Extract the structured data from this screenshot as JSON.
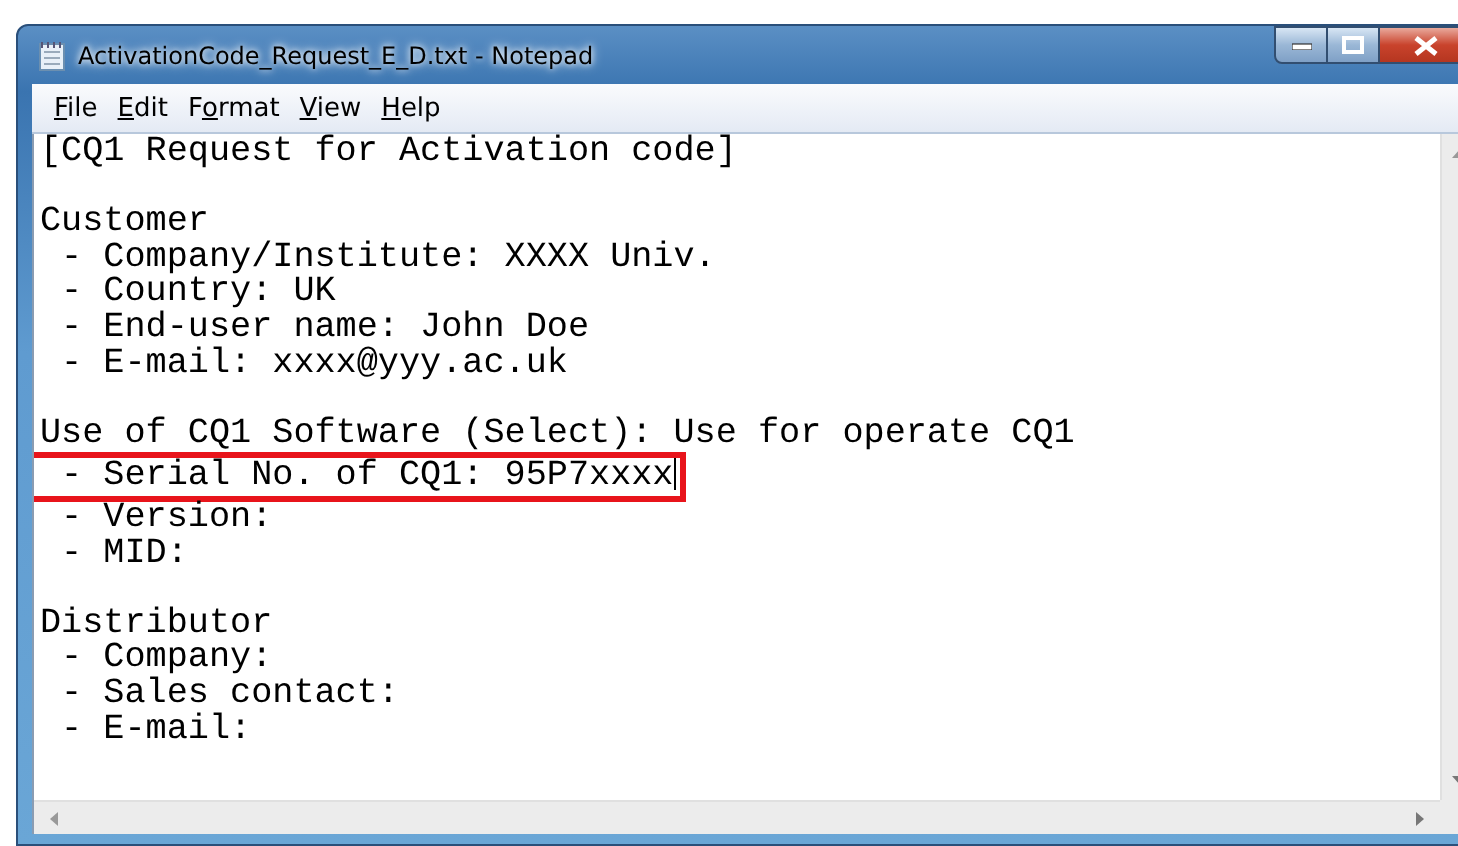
{
  "window": {
    "title": "ActivationCode_Request_E_D.txt - Notepad"
  },
  "menu": [
    {
      "label": "File"
    },
    {
      "label": "Edit"
    },
    {
      "label": "Format"
    },
    {
      "label": "View"
    },
    {
      "label": "Help"
    }
  ],
  "document": {
    "paragraphs": [
      [
        {
          "text": "[CQ1 Request for Activation code]",
          "highlighted": false,
          "cursor": false
        }
      ],
      [
        {
          "text": "Customer",
          "highlighted": false,
          "cursor": false
        },
        {
          "text": " - Company/Institute: XXXX Univ.",
          "highlighted": false,
          "cursor": false
        },
        {
          "text": " - Country: UK",
          "highlighted": false,
          "cursor": false
        },
        {
          "text": " - End-user name: John Doe",
          "highlighted": false,
          "cursor": false
        },
        {
          "text": " - E-mail: xxxx@yyy.ac.uk",
          "highlighted": false,
          "cursor": false
        }
      ],
      [
        {
          "text": "Use of CQ1 Software (Select): Use for operate CQ1",
          "highlighted": false,
          "cursor": false
        },
        {
          "text": " - Serial No. of CQ1: 95P7xxxx",
          "highlighted": true,
          "cursor": true
        },
        {
          "text": " - Version:",
          "highlighted": false,
          "cursor": false
        },
        {
          "text": " - MID:",
          "highlighted": false,
          "cursor": false
        }
      ],
      [
        {
          "text": "Distributor",
          "highlighted": false,
          "cursor": false
        },
        {
          "text": " - Company:",
          "highlighted": false,
          "cursor": false
        },
        {
          "text": " - Sales contact:",
          "highlighted": false,
          "cursor": false
        },
        {
          "text": " - E-mail:",
          "highlighted": false,
          "cursor": false
        }
      ]
    ]
  }
}
